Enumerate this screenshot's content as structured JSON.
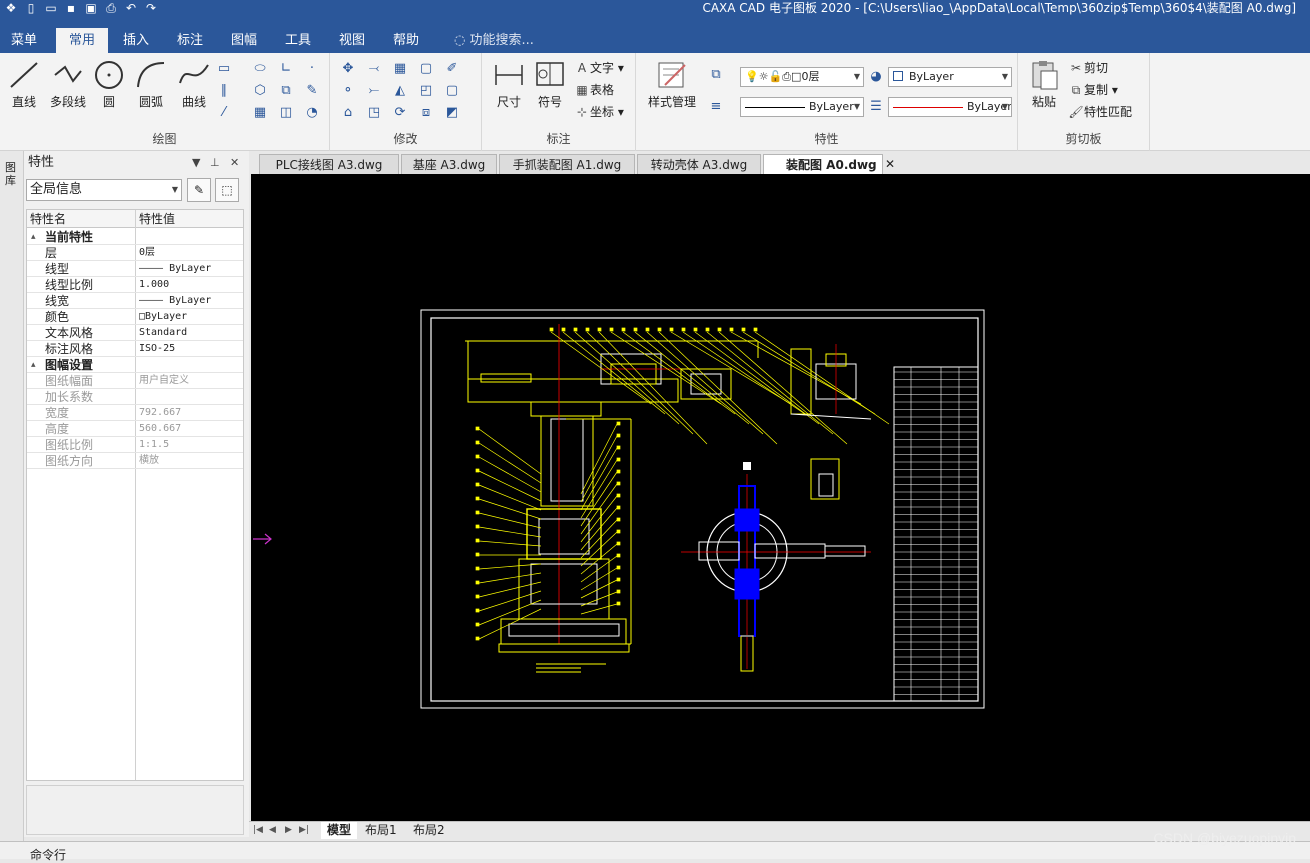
{
  "titlebar": {
    "title": "CAXA CAD 电子图板 2020 - [C:\\Users\\liao_\\AppData\\Local\\Temp\\360zip$Temp\\360$4\\装配图 A0.dwg]",
    "qat_icons": [
      "app-icon",
      "new-icon",
      "open-icon",
      "save-icon",
      "saveas-icon",
      "print-icon",
      "undo-icon",
      "redo-icon"
    ]
  },
  "ribbon_tabs": {
    "menu": "菜单",
    "common": "常用",
    "insert": "插入",
    "annotate": "标注",
    "sheet": "图幅",
    "tools": "工具",
    "view": "视图",
    "help": "帮助",
    "search": "功能搜索..."
  },
  "draw_group": {
    "name": "绘图",
    "line": "直线",
    "polyline": "多段线",
    "circle": "圆",
    "arc": "圆弧",
    "curve": "曲线"
  },
  "modify_group": {
    "name": "修改"
  },
  "annotate_group": {
    "name": "标注",
    "dimension": "尺寸",
    "symbol": "符号",
    "text": "文字",
    "table": "表格",
    "coordinate": "坐标"
  },
  "properties_group": {
    "name": "特性",
    "style_manage": "样式管理",
    "layer": "0层",
    "color": "ByLayer",
    "linetype": "ByLayer",
    "lineweight": "ByLayer"
  },
  "clipboard_group": {
    "name": "剪切板",
    "paste": "粘贴",
    "cut": "剪切",
    "copy": "复制",
    "match": "特性匹配"
  },
  "left_strip": {
    "label": "图库"
  },
  "properties_panel": {
    "title": "特性",
    "selector": "全局信息",
    "col_name": "特性名",
    "col_value": "特性值",
    "rows": [
      {
        "name": "当前特性",
        "value": "",
        "kind": "cat"
      },
      {
        "name": "层",
        "value": "0层",
        "kind": "item"
      },
      {
        "name": "线型",
        "value": "———— ByLayer",
        "kind": "item"
      },
      {
        "name": "线型比例",
        "value": "1.000",
        "kind": "item"
      },
      {
        "name": "线宽",
        "value": "———— ByLayer",
        "kind": "item"
      },
      {
        "name": "颜色",
        "value": "□ByLayer",
        "kind": "item"
      },
      {
        "name": "文本风格",
        "value": "Standard",
        "kind": "item"
      },
      {
        "name": "标注风格",
        "value": "ISO-25",
        "kind": "item"
      },
      {
        "name": "图幅设置",
        "value": "",
        "kind": "cat"
      },
      {
        "name": "图纸幅面",
        "value": "用户自定义",
        "kind": "dim"
      },
      {
        "name": "加长系数",
        "value": "",
        "kind": "dim"
      },
      {
        "name": "宽度",
        "value": "792.667",
        "kind": "dim"
      },
      {
        "name": "高度",
        "value": "560.667",
        "kind": "dim"
      },
      {
        "name": "图纸比例",
        "value": "1:1.5",
        "kind": "dim"
      },
      {
        "name": "图纸方向",
        "value": "横放",
        "kind": "dim"
      }
    ]
  },
  "doc_tabs": [
    {
      "label": "PLC接线图 A3.dwg",
      "active": false
    },
    {
      "label": "基座 A3.dwg",
      "active": false
    },
    {
      "label": "手抓装配图 A1.dwg",
      "active": false
    },
    {
      "label": "转动壳体 A3.dwg",
      "active": false
    },
    {
      "label": "装配图 A0.dwg",
      "active": true
    }
  ],
  "layout_tabs": {
    "model": "模型",
    "layout1": "布局1",
    "layout2": "布局2"
  },
  "command_line": {
    "label": "命令行"
  },
  "watermark": "CSDN @biyezuopinvip",
  "colors": {
    "titlebar": "#2b579a",
    "canvas": "#000000",
    "drawing_yellow": "#ffff00",
    "drawing_red": "#ff0000",
    "drawing_blue": "#0000ff",
    "drawing_white": "#ffffff",
    "cursor_magenta": "#cc33cc"
  }
}
